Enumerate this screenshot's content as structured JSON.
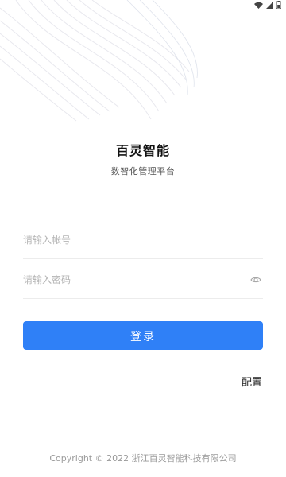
{
  "app": {
    "title": "百灵智能",
    "subtitle": "数智化管理平台"
  },
  "form": {
    "account_placeholder": "请输入帐号",
    "password_placeholder": "请输入密码",
    "login_label": "登录",
    "config_label": "配置"
  },
  "footer": {
    "copyright": "Copyright © 2022 浙江百灵智能科技有限公司"
  },
  "icons": {
    "password_toggle": "eye-icon",
    "status": [
      "wifi-icon",
      "signal-icon",
      "battery-icon"
    ]
  },
  "colors": {
    "primary": "#2f80f7",
    "background": "#ffffff",
    "placeholder": "#b4b4b4"
  }
}
